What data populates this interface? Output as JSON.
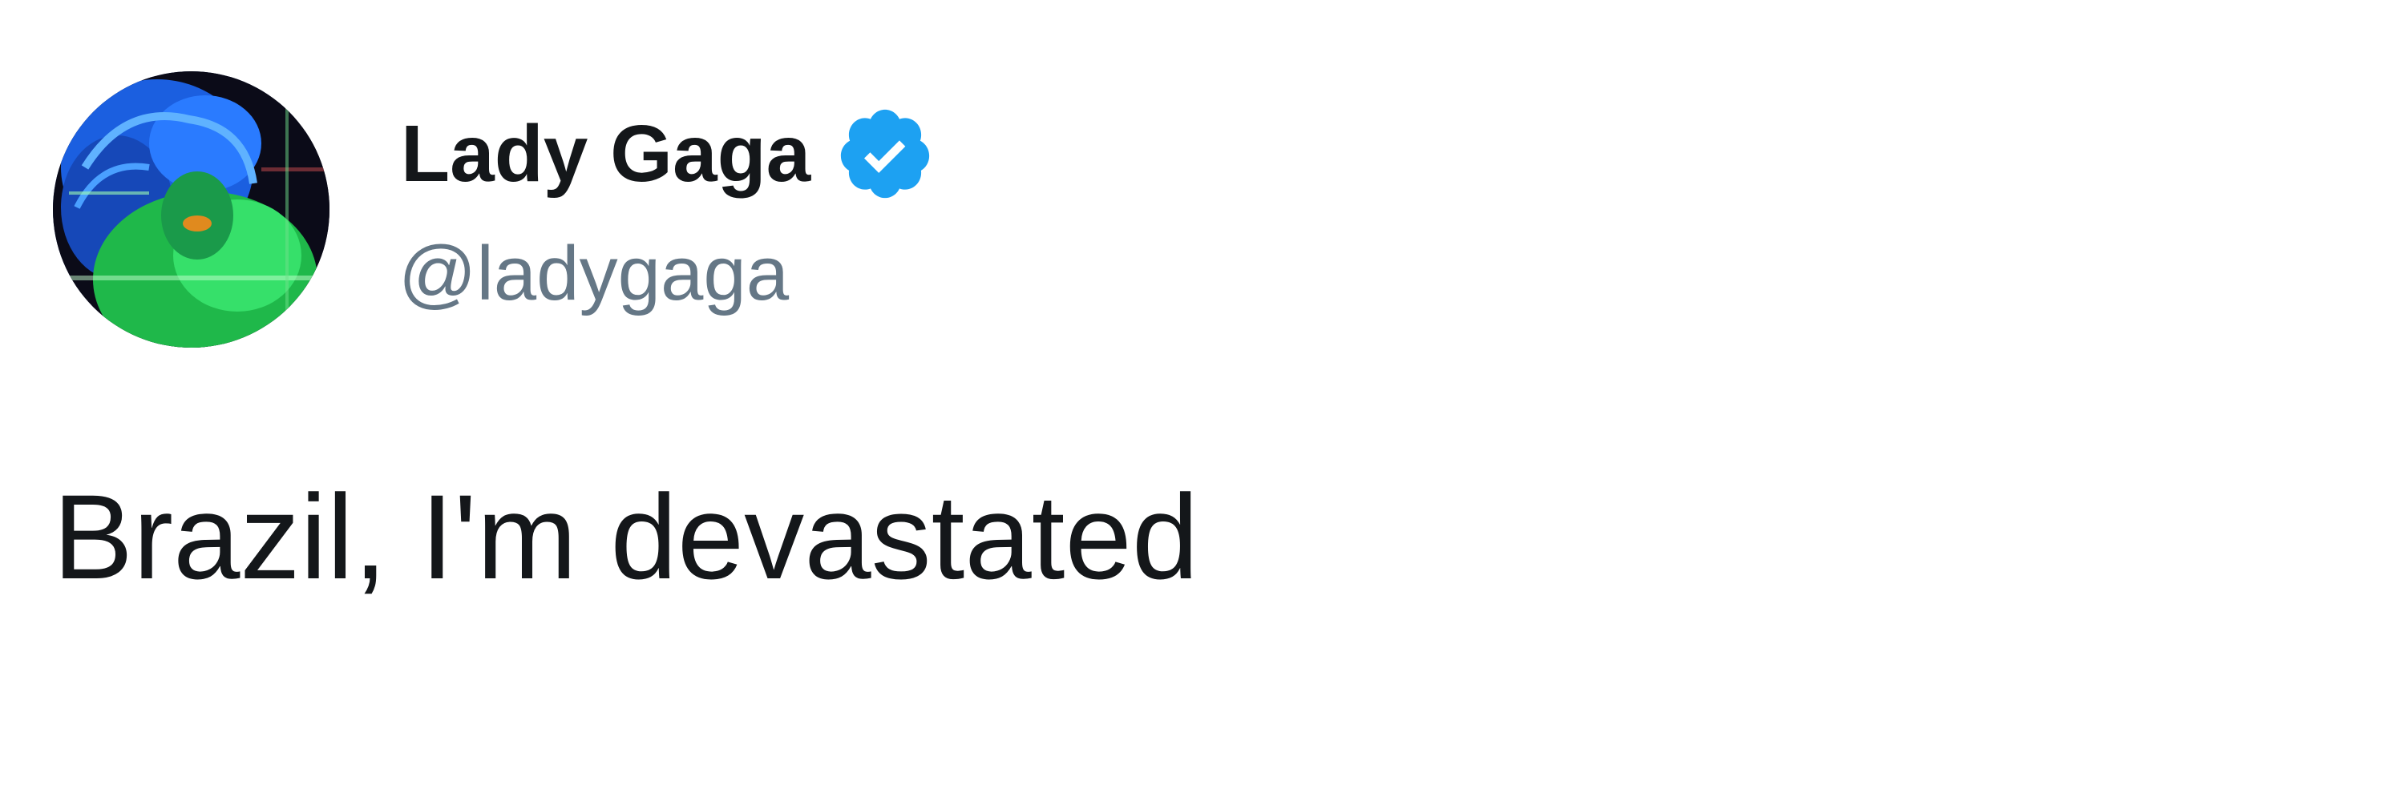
{
  "tweet": {
    "author": {
      "display_name": "Lady Gaga",
      "handle": "@ladygaga",
      "verified": true,
      "avatar_icon": "avatar-portrait"
    },
    "text": "Brazil, I'm devastated",
    "colors": {
      "name": "#14171a",
      "handle": "#657786",
      "verified_badge": "#1da1f2",
      "text": "#14171a",
      "background": "#ffffff"
    }
  }
}
